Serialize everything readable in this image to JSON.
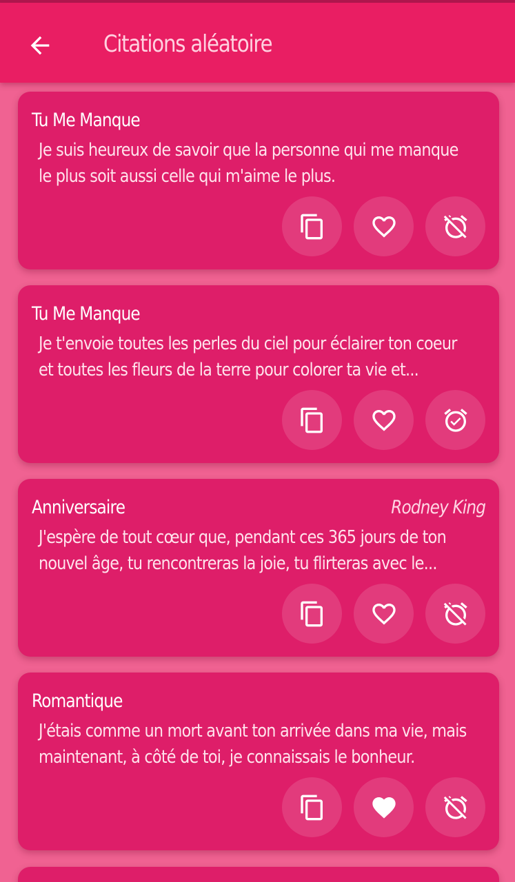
{
  "appbar": {
    "title": "Citations aléatoire",
    "back_icon": "arrow-left-icon"
  },
  "colors": {
    "appbar": "#e91e63",
    "background": "#f06292",
    "card": "#de1e69",
    "text": "#ffffff"
  },
  "quotes": [
    {
      "category": "Tu Me Manque",
      "author": "",
      "lines": [
        "Je suis heureux de savoir que la personne qui me manque",
        "le plus soit aussi celle qui m'aime le plus."
      ],
      "favorite": false,
      "reminder_set": false
    },
    {
      "category": "Tu Me Manque",
      "author": "",
      "lines": [
        "Je t'envoie toutes les perles du ciel pour éclairer ton coeur",
        "et toutes les fleurs de la terre pour colorer ta vie et..."
      ],
      "favorite": false,
      "reminder_set": true
    },
    {
      "category": "Anniversaire",
      "author": "Rodney King",
      "lines": [
        "J'espère de tout cœur que, pendant ces 365 jours de ton",
        "nouvel âge, tu rencontreras la joie, tu flirteras avec le..."
      ],
      "favorite": false,
      "reminder_set": false
    },
    {
      "category": "Romantique",
      "author": "",
      "lines": [
        "J'étais comme un mort avant ton arrivée dans ma vie, mais",
        "maintenant, à côté de toi, je connaissais le bonheur."
      ],
      "favorite": true,
      "reminder_set": false
    }
  ],
  "actions": {
    "copy_icon": "copy-icon",
    "favorite_icon": "heart-icon",
    "reminder_icon": "alarm-icon"
  }
}
